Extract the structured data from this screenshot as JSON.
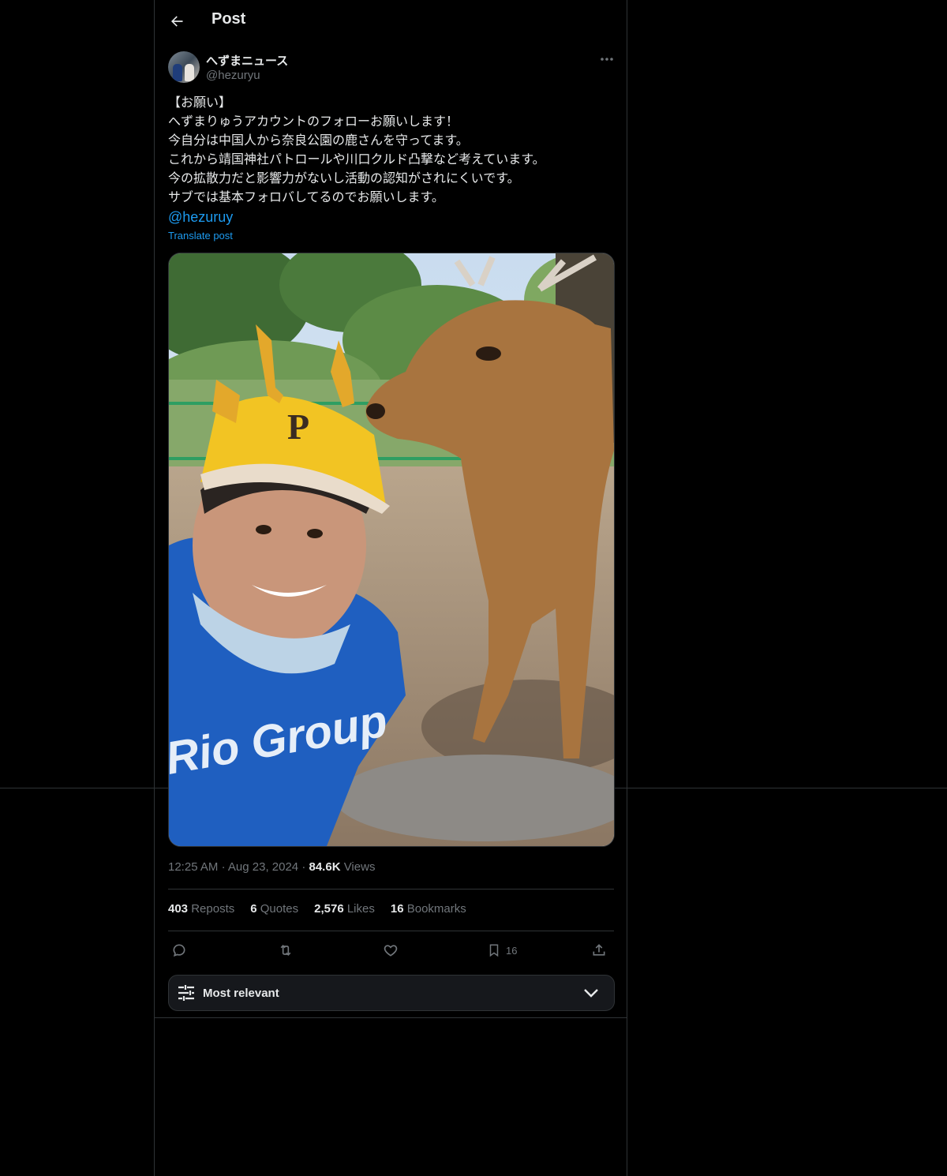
{
  "header": {
    "title": "Post"
  },
  "author": {
    "display_name": "へずまニュース",
    "handle": "@hezuryu"
  },
  "tweet": {
    "lines": [
      "【お願い】",
      "へずまりゅうアカウントのフォローお願いします！",
      "今自分は中国人から奈良公園の鹿さんを守ってます。",
      "これから靖国神社パトロールや川口クルド凸撃など考えています。",
      "今の拡散力だと影響力がないし活動の認知がされにくいです。",
      "サブでは基本フォロバしてるのでお願いします。"
    ],
    "mention": "@hezuruy",
    "translate_label": "Translate post",
    "shirt_text": "Rio Group"
  },
  "meta": {
    "time": "12:25 AM",
    "date": "Aug 23, 2024",
    "views_count": "84.6K",
    "views_label": "Views",
    "sep": "·"
  },
  "stats": {
    "reposts": {
      "count": "403",
      "label": "Reposts"
    },
    "quotes": {
      "count": "6",
      "label": "Quotes"
    },
    "likes": {
      "count": "2,576",
      "label": "Likes"
    },
    "bookmarks": {
      "count": "16",
      "label": "Bookmarks"
    }
  },
  "actions": {
    "bookmark_count": "16"
  },
  "sort": {
    "label": "Most relevant"
  },
  "icons": [
    "arrow-left-icon",
    "more-icon",
    "reply-icon",
    "repost-icon",
    "like-icon",
    "bookmark-icon",
    "share-icon",
    "filter-icon",
    "chevron-down-icon"
  ],
  "colors": {
    "background": "#000000",
    "text": "#e7e9ea",
    "muted": "#71767b",
    "accent": "#1d9bf0",
    "border": "#2f3336"
  }
}
